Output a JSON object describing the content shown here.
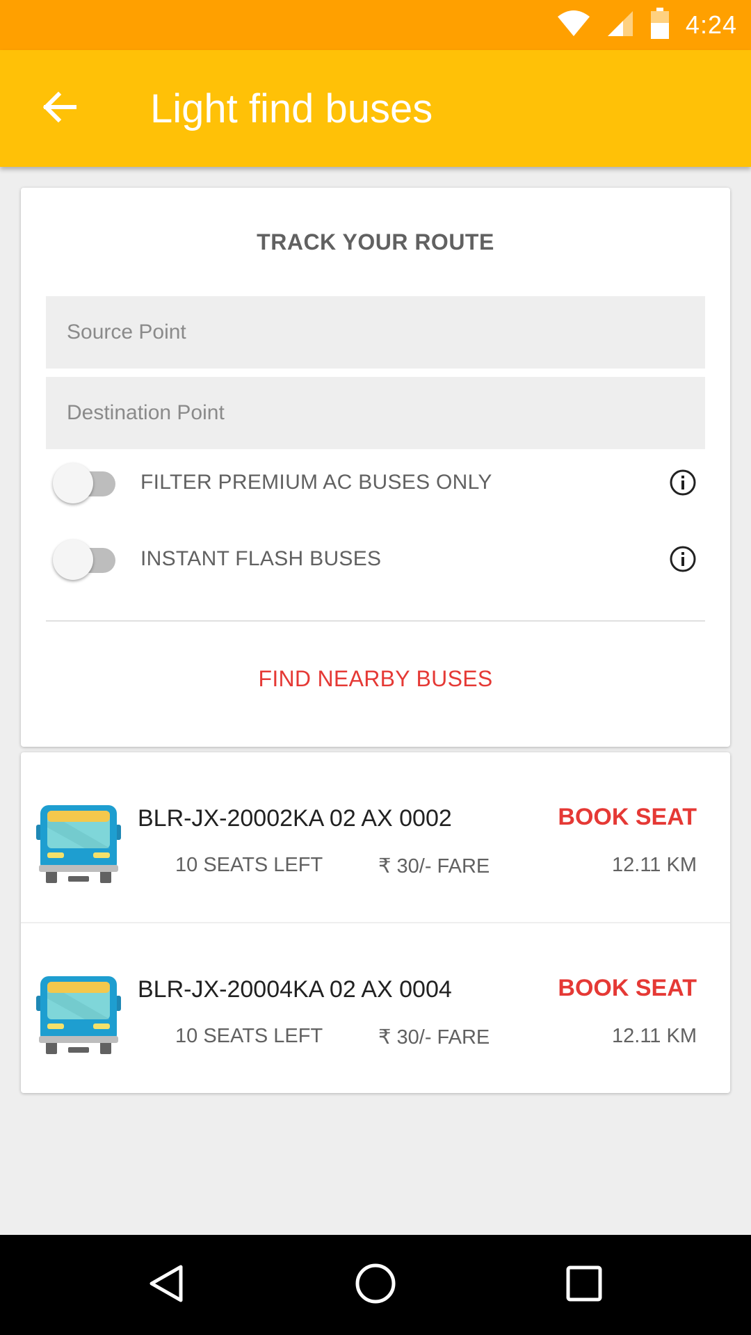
{
  "status_bar": {
    "time": "4:24",
    "icons": [
      "wifi-icon",
      "cell-signal-icon",
      "battery-icon"
    ]
  },
  "app_bar": {
    "title": "Light find buses",
    "back_icon": "arrow-back-icon"
  },
  "route_card": {
    "heading": "TRACK YOUR ROUTE",
    "source": {
      "placeholder": "Source Point",
      "value": ""
    },
    "destination": {
      "placeholder": "Destination Point",
      "value": ""
    },
    "toggles": [
      {
        "label": "FILTER PREMIUM AC BUSES ONLY",
        "on": false,
        "icon": "info-icon"
      },
      {
        "label": "INSTANT FLASH BUSES",
        "on": false,
        "icon": "info-icon"
      }
    ],
    "action": "FIND NEARBY BUSES"
  },
  "buses": [
    {
      "number": "BLR-JX-20002KA 02 AX 0002",
      "seats": "10 SEATS LEFT",
      "fare": "₹ 30/- FARE",
      "action": "BOOK SEAT",
      "distance": "12.11 KM"
    },
    {
      "number": "BLR-JX-20004KA 02 AX 0004",
      "seats": "10 SEATS LEFT",
      "fare": "₹ 30/- FARE",
      "action": "BOOK SEAT",
      "distance": "12.11 KM"
    }
  ],
  "nav_bar": {
    "icons": [
      "nav-back-icon",
      "nav-home-icon",
      "nav-recents-icon"
    ]
  },
  "colors": {
    "status_bar": "#ffa000",
    "app_bar": "#ffc107",
    "accent_red": "#e53935",
    "background": "#eeeeee"
  }
}
